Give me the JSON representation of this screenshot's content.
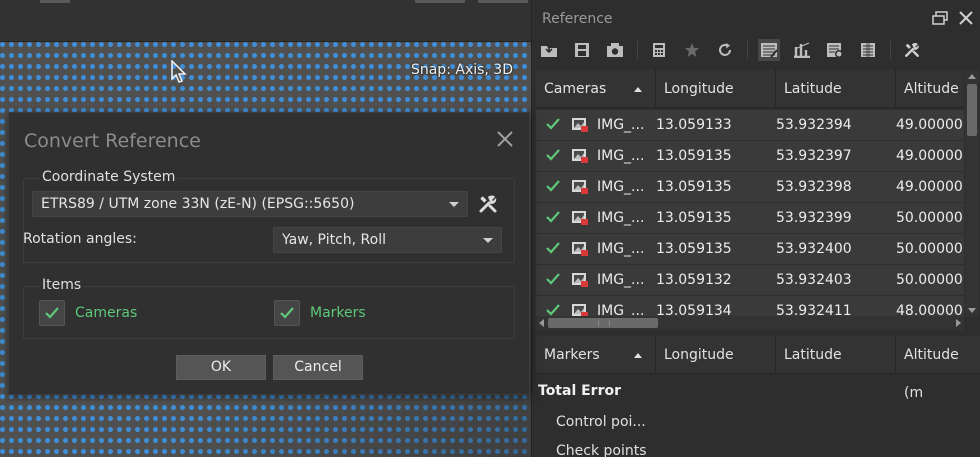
{
  "viewport": {
    "snap_label": "Snap: Axis, 3D"
  },
  "dialog": {
    "title": "Convert Reference",
    "coordinate_system": {
      "group_title": "Coordinate System",
      "selected": "ETRS89 / UTM zone 33N (zE-N) (EPSG::5650)",
      "rotation_label": "Rotation angles:",
      "rotation_selected": "Yaw, Pitch, Roll"
    },
    "items": {
      "group_title": "Items",
      "cameras": {
        "label": "Cameras",
        "checked": true
      },
      "markers": {
        "label": "Markers",
        "checked": true
      }
    },
    "ok_label": "OK",
    "cancel_label": "Cancel"
  },
  "reference_panel": {
    "title": "Reference",
    "toolbar_icons": [
      "import-icon",
      "export-icon",
      "convert-icon",
      "calculator-icon",
      "star-icon",
      "refresh-icon",
      "view-source-icon",
      "view-errors-icon",
      "view-estimated-icon",
      "view-variance-icon",
      "settings-icon"
    ],
    "cameras_table": {
      "columns": [
        "Cameras",
        "Longitude",
        "Latitude",
        "Altitude"
      ],
      "rows": [
        {
          "label": "IMG_...",
          "longitude": "13.059133",
          "latitude": "53.932394",
          "altitude": "49.00000",
          "checked": true
        },
        {
          "label": "IMG_...",
          "longitude": "13.059135",
          "latitude": "53.932397",
          "altitude": "49.00000",
          "checked": true
        },
        {
          "label": "IMG_...",
          "longitude": "13.059135",
          "latitude": "53.932398",
          "altitude": "49.00000",
          "checked": true
        },
        {
          "label": "IMG_...",
          "longitude": "13.059135",
          "latitude": "53.932399",
          "altitude": "50.00000",
          "checked": true
        },
        {
          "label": "IMG_...",
          "longitude": "13.059135",
          "latitude": "53.932400",
          "altitude": "50.00000",
          "checked": true
        },
        {
          "label": "IMG_...",
          "longitude": "13.059132",
          "latitude": "53.932403",
          "altitude": "50.00000",
          "checked": true
        },
        {
          "label": "IMG_...",
          "longitude": "13.059134",
          "latitude": "53.932411",
          "altitude": "48.00000",
          "checked": true
        }
      ]
    },
    "markers_table": {
      "columns": [
        "Markers",
        "Longitude",
        "Latitude",
        "Altitude (m"
      ]
    },
    "total_error": {
      "title": "Total Error",
      "items": [
        "Control poi...",
        "Check points"
      ]
    }
  },
  "colors": {
    "check_green": "#5fc87a",
    "point_blue": "#3f8fd8"
  }
}
